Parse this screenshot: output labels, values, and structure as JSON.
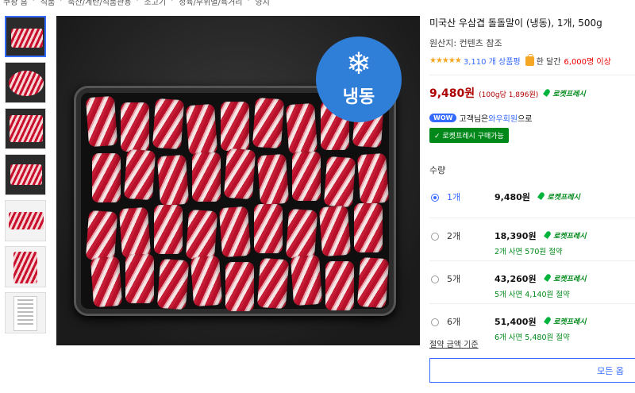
{
  "breadcrumb": [
    "쿠팡 홈",
    "식품",
    "축산/계란/식품관용",
    "소고기",
    "정육/부위별/육거리",
    "양지"
  ],
  "product": {
    "title": "미국산 우삼겹 돌돌말이 (냉동), 1개, 500g",
    "origin": "원산지: 컨텐츠 참조",
    "stars": "★★★★★",
    "review_count": "3,110 개 상품평",
    "month_text": "한 달간",
    "buyers": "6,000명 이상",
    "price": "9,480원",
    "unit_price": "(100g당 1,896원)",
    "rocket_label": "로켓프레시",
    "frozen_badge": "냉동",
    "frozen_icon": "snowflake-icon"
  },
  "wow": {
    "badge": "WOW",
    "prefix": "고객님은 ",
    "member": "와우회원",
    "suffix": "으로",
    "button": "로켓프레시 구매가능"
  },
  "quantity": {
    "label": "수량",
    "options": [
      {
        "qty": "1개",
        "price": "9,480원",
        "save": "",
        "selected": true
      },
      {
        "qty": "2개",
        "price": "18,390원",
        "save": "2개 사면 570원 절약",
        "selected": false
      },
      {
        "qty": "5개",
        "price": "43,260원",
        "save": "5개 사면 4,140원 절약",
        "selected": false
      },
      {
        "qty": "6개",
        "price": "51,400원",
        "save": "6개 사면 5,480원 절약",
        "selected": false
      }
    ]
  },
  "calc_note": "절약 금액 기준",
  "more_button": "모든 옵"
}
